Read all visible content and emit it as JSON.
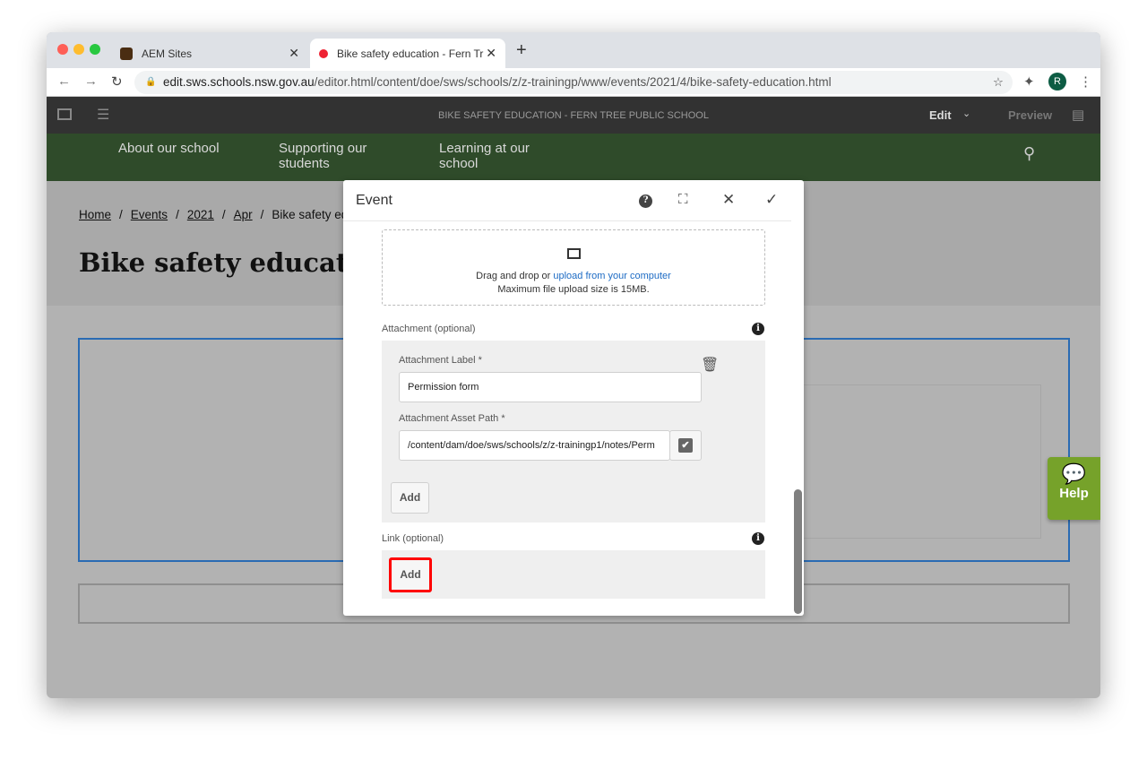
{
  "browser": {
    "tabs": [
      {
        "label": "AEM Sites",
        "active": false
      },
      {
        "label": "Bike safety education - Fern Tr",
        "active": true
      }
    ],
    "url_host": "edit.sws.schools.nsw.gov.au",
    "url_path": "/editor.html/content/doe/sws/schools/z/z-trainingp/www/events/2021/4/bike-safety-education.html",
    "profile_initial": "R"
  },
  "editor": {
    "page_title": "BIKE SAFETY EDUCATION - FERN TREE PUBLIC SCHOOL",
    "mode": "Edit",
    "preview": "Preview"
  },
  "site_nav": {
    "items": [
      "About our school",
      "Supporting our students",
      "Learning at our school"
    ]
  },
  "breadcrumb": [
    "Home",
    "Events",
    "2021",
    "Apr",
    "Bike safety education"
  ],
  "page_heading": "Bike safety education",
  "help_label": "Help",
  "dialog": {
    "title": "Event",
    "upload": {
      "text": "Drag and drop or ",
      "link": "upload from your computer",
      "limit": "Maximum file upload size is 15MB."
    },
    "attachment": {
      "section_label": "Attachment (optional)",
      "label_field_label": "Attachment Label *",
      "label_value": "Permission form",
      "path_field_label": "Attachment Asset Path *",
      "path_value": "/content/dam/doe/sws/schools/z/z-trainingp1/notes/Perm",
      "add_label": "Add"
    },
    "link": {
      "section_label": "Link (optional)",
      "add_label": "Add"
    }
  },
  "colors": {
    "site_nav": "#2f4b2a",
    "help": "#76a22a",
    "highlight": "#ff0000",
    "link": "#1d6bc4"
  }
}
